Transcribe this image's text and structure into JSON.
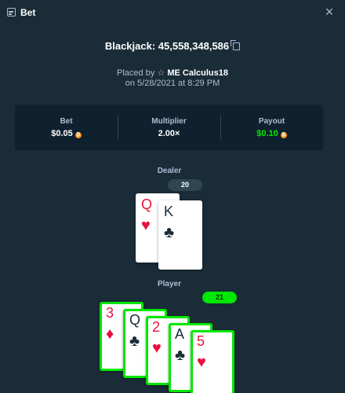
{
  "header": {
    "icon": "bet-icon",
    "title": "Bet",
    "close": "×"
  },
  "game": {
    "title": "Blackjack: 45,558,348,586",
    "placed_by_prefix": "Placed by",
    "user": "ME Calculus18",
    "date": "on 5/28/2021 at 8:29 PM"
  },
  "stats": [
    {
      "label": "Bet",
      "value": "$0.05"
    },
    {
      "label": "Multiplier",
      "value": "2.00×"
    },
    {
      "label": "Payout",
      "value": "$0.10"
    }
  ],
  "dealer": {
    "label": "Dealer",
    "total": "20",
    "cards": [
      {
        "rank": "Q",
        "suit": "♥",
        "color": "red"
      },
      {
        "rank": "K",
        "suit": "♣",
        "color": "black"
      }
    ]
  },
  "player": {
    "label": "Player",
    "total": "21",
    "cards": [
      {
        "rank": "3",
        "suit": "♦",
        "color": "red"
      },
      {
        "rank": "Q",
        "suit": "♣",
        "color": "black"
      },
      {
        "rank": "2",
        "suit": "♥",
        "color": "red"
      },
      {
        "rank": "A",
        "suit": "♣",
        "color": "black"
      },
      {
        "rank": "5",
        "suit": "♥",
        "color": "red"
      }
    ]
  },
  "colors": {
    "background": "#1a2c38",
    "panel": "#0f212e",
    "accent": "#00e701",
    "card_red": "#e9113c",
    "coin": "#f7931a"
  }
}
